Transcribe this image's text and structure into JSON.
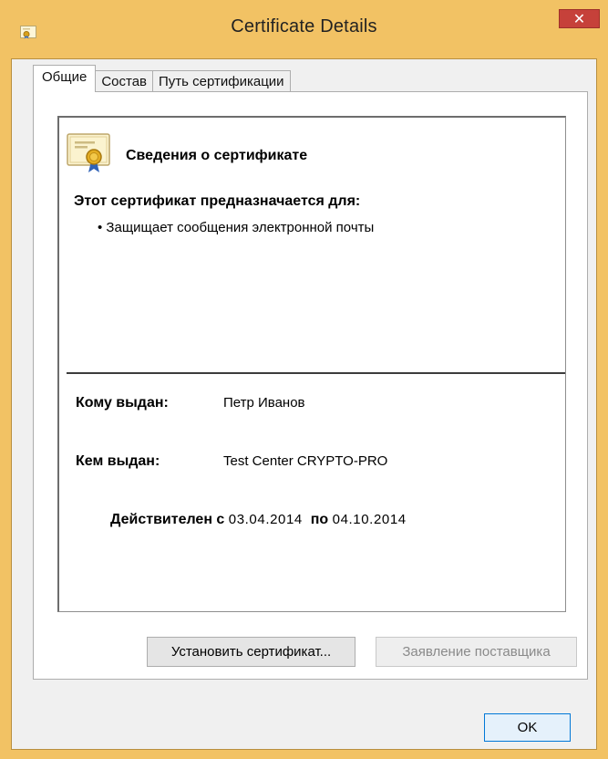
{
  "window": {
    "title": "Certificate Details",
    "close_glyph": "✕"
  },
  "tabs": [
    {
      "label": "Общие",
      "active": true
    },
    {
      "label": "Состав",
      "active": false
    },
    {
      "label": "Путь сертификации",
      "active": false
    }
  ],
  "general": {
    "header": "Сведения о сертификате",
    "purpose_title": "Этот сертификат предназначается для:",
    "purposes": [
      "• Защищает сообщения электронной почты"
    ],
    "issued_to_label": "Кому выдан:",
    "issued_to_value": "Петр Иванов",
    "issued_by_label": "Кем выдан:",
    "issued_by_value": "Test Center CRYPTO-PRO",
    "valid_from_label": "Действителен с",
    "valid_from_value": "03.04.2014",
    "valid_to_label": "по",
    "valid_to_value": "04.10.2014"
  },
  "buttons": {
    "install": "Установить сертификат...",
    "issuer_statement": "Заявление поставщика",
    "ok": "OK"
  },
  "icons": {
    "title_icon": "certificate-icon",
    "cert_icon": "certificate-icon",
    "close_icon": "close-icon"
  },
  "colors": {
    "title_bar": "#f2c264",
    "close_button": "#c6413a"
  }
}
